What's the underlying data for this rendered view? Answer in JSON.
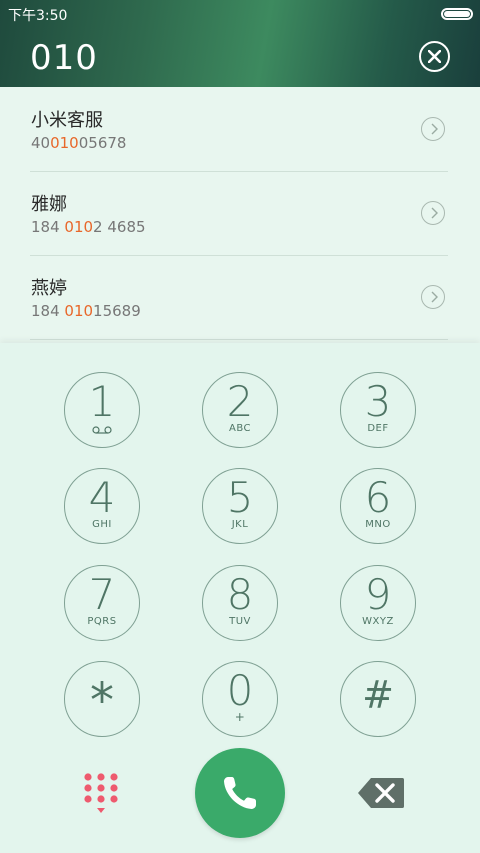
{
  "status_bar": {
    "time": "下午3:50"
  },
  "dialer": {
    "number": "010"
  },
  "results": [
    {
      "name": "小米客服",
      "number_parts": [
        "40",
        "010",
        "05678"
      ]
    },
    {
      "name": "雅娜",
      "number_parts": [
        "184 ",
        "010",
        "2 4685"
      ]
    },
    {
      "name": "燕婷",
      "number_parts": [
        "184 ",
        "010",
        "15689"
      ]
    }
  ],
  "keys": [
    {
      "digit": "1",
      "letters": ""
    },
    {
      "digit": "2",
      "letters": "ABC"
    },
    {
      "digit": "3",
      "letters": "DEF"
    },
    {
      "digit": "4",
      "letters": "GHI"
    },
    {
      "digit": "5",
      "letters": "JKL"
    },
    {
      "digit": "6",
      "letters": "MNO"
    },
    {
      "digit": "7",
      "letters": "PQRS"
    },
    {
      "digit": "8",
      "letters": "TUV"
    },
    {
      "digit": "9",
      "letters": "WXYZ"
    },
    {
      "digit": "*",
      "letters": ""
    },
    {
      "digit": "0",
      "letters": "+"
    },
    {
      "digit": "#",
      "letters": ""
    }
  ],
  "colors": {
    "highlight": "#e8672a",
    "call_button": "#3aaa6a",
    "keypad_dots": "#ee5a6e",
    "key_outline": "#7fa093"
  },
  "icons": {
    "voicemail": "voicemail-icon",
    "clear": "close-icon",
    "arrow": "chevron-right-icon",
    "keypad_toggle": "dialpad-icon",
    "call": "phone-icon",
    "backspace": "backspace-icon"
  }
}
